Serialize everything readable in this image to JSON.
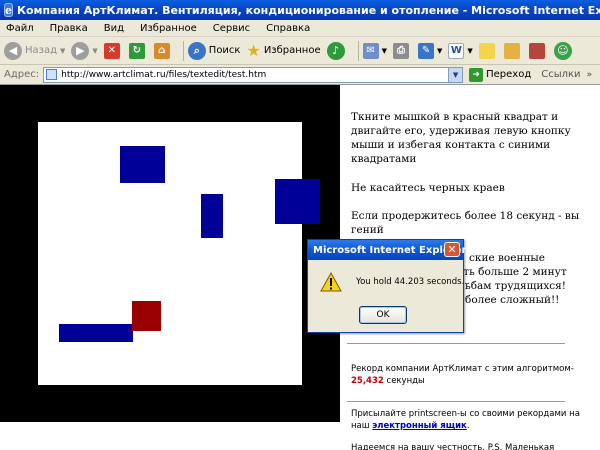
{
  "window": {
    "title": "Компания АртКлимат. Вентиляция, кондиционирование и отопление - Microsoft Internet Explorer"
  },
  "menu": [
    "Файл",
    "Правка",
    "Вид",
    "Избранное",
    "Сервис",
    "Справка"
  ],
  "toolbar": {
    "back_label": "Назад",
    "search_label": "Поиск",
    "favorites_label": "Избранное"
  },
  "address": {
    "label": "Адрес:",
    "url": "http://www.artclimat.ru/files/textedit/test.htm",
    "go_label": "Переход",
    "links_label": "Ссылки"
  },
  "content": {
    "instructions": "Ткните мышкой в красный квадрат и двигайте его, удерживая левую кнопку мыши и избегая контакта с синими квадратами",
    "avoid_edges": "Не касайтесь черных краев",
    "genius": "Если продержитесь более 18 секунд - вы гений",
    "p4_line1": "ские военные",
    "p4_line2": "ать больше 2 минут",
    "p4_line3": "ьбам трудящихся!",
    "p4_line4": "более сложный!!",
    "record_text": "Рекорд компании АртКлимат с этим алгоритмом-",
    "record_value": "25,432",
    "record_unit": " секунды",
    "send_text": "Присылайте printscreen-ы со своими рекордами на наш ",
    "send_link": "электронный ящик",
    "send_end": ".",
    "hope_text": "Надеемся на вашу честность. P.S. Маленькая"
  },
  "dialog": {
    "title": "Microsoft Internet Explorer",
    "message": "You hold 44.203 seconds...",
    "ok_label": "OK"
  },
  "colors": {
    "blue": "#000099",
    "red": "#990000",
    "record": "#cc0000"
  }
}
